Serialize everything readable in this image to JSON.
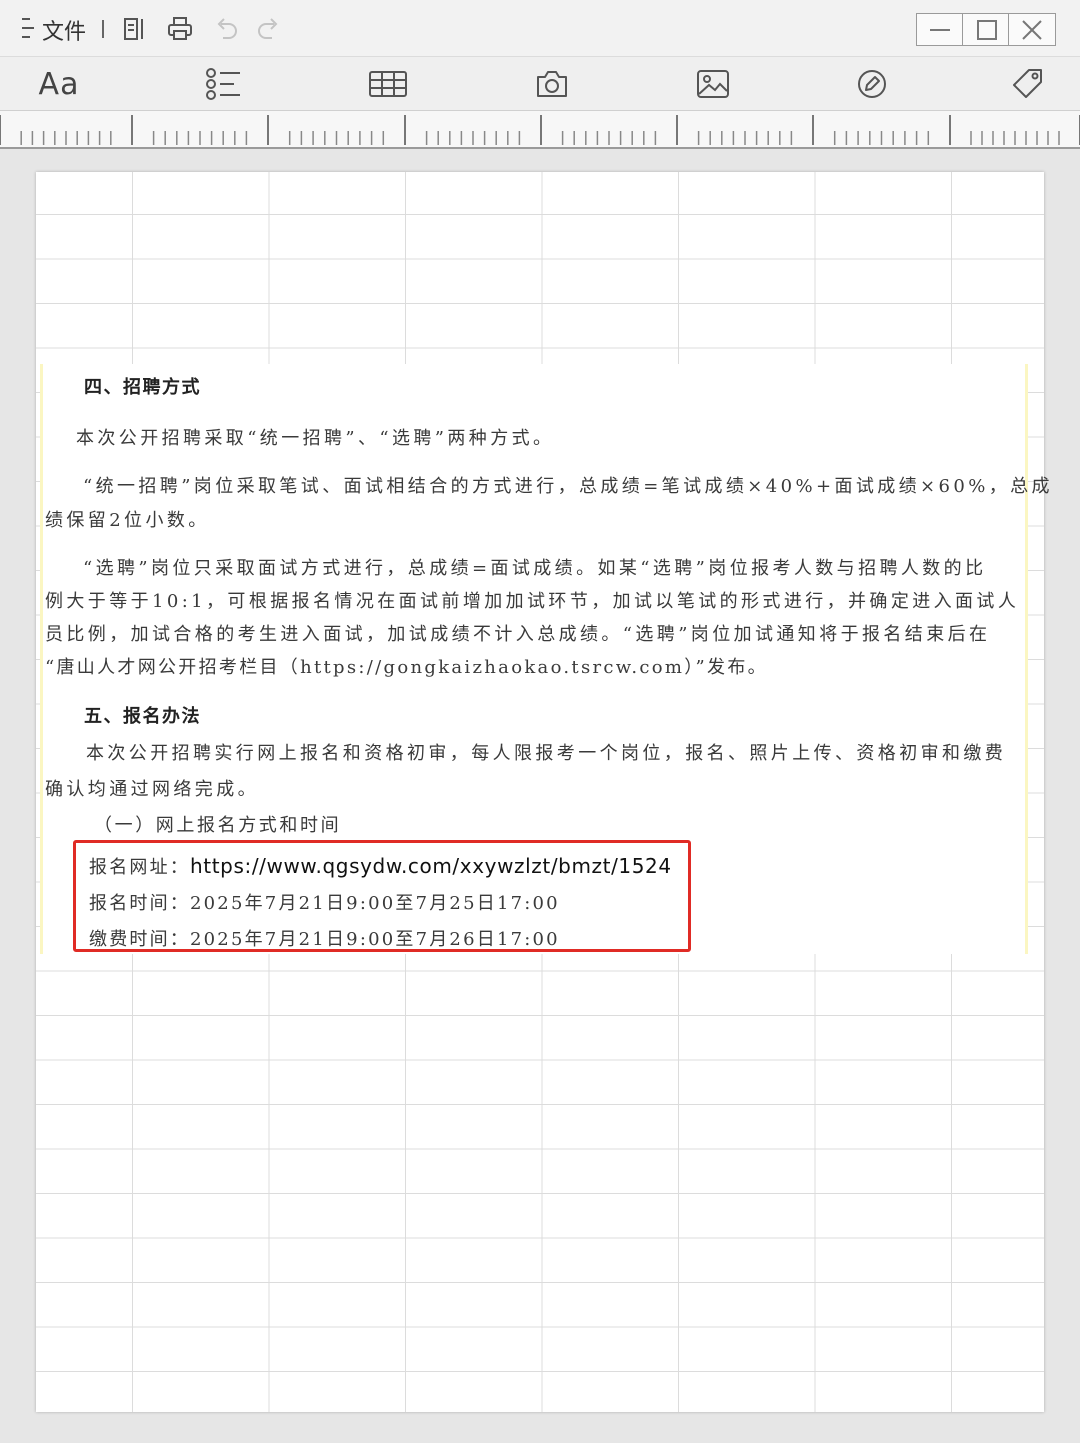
{
  "titlebar": {
    "file_label": "文件",
    "icons": [
      "menu-icon",
      "outline-icon",
      "print-icon",
      "undo-icon",
      "redo-icon"
    ],
    "window_controls": [
      "minimize-icon",
      "maximize-icon",
      "close-icon"
    ]
  },
  "toolbar": {
    "font_label": "Aa",
    "icons": [
      "list-icon",
      "table-icon",
      "camera-icon",
      "image-icon",
      "pen-icon",
      "tag-icon"
    ]
  },
  "document": {
    "heading4": "四、招聘方式",
    "p1": "本次公开招聘采取“统一招聘”、“选聘”两种方式。",
    "p2_line1": "“统一招聘”岗位采取笔试、面试相结合的方式进行，总成绩=笔试成绩×40%+面试成绩×60%，总成",
    "p2_line2": "绩保留2位小数。",
    "p3_line1": "“选聘”岗位只采取面试方式进行，总成绩=面试成绩。如某“选聘”岗位报考人数与招聘人数的比",
    "p3_line2": "例大于等于10:1，可根据报名情况在面试前增加加试环节，加试以笔试的形式进行，并确定进入面试人",
    "p3_line3": "员比例，加试合格的考生进入面试，加试成绩不计入总成绩。“选聘”岗位加试通知将于报名结束后在",
    "p3_line4": "“唐山人才网公开招考栏目（https://gongkaizhaokao.tsrcw.com）”发布。",
    "heading5": "五、报名办法",
    "p4_line1": "本次公开招聘实行网上报名和资格初审，每人限报考一个岗位，报名、照片上传、资格初审和缴费",
    "p4_line2": "确认均通过网络完成。",
    "sub1": "（一）网上报名方式和时间",
    "reg_url_label": "报名网址：",
    "reg_url": "https://www.qgsydw.com/xxywzlzt/bmzt/1524",
    "reg_time": "报名时间：2025年7月21日9:00至7月25日17:00",
    "pay_time": "缴费时间：2025年7月21日9:00至7月26日17:00"
  },
  "colors": {
    "highlight_border": "#e02b25",
    "page_background": "#e6e6e6",
    "grid_line": "#dcdcdc"
  }
}
